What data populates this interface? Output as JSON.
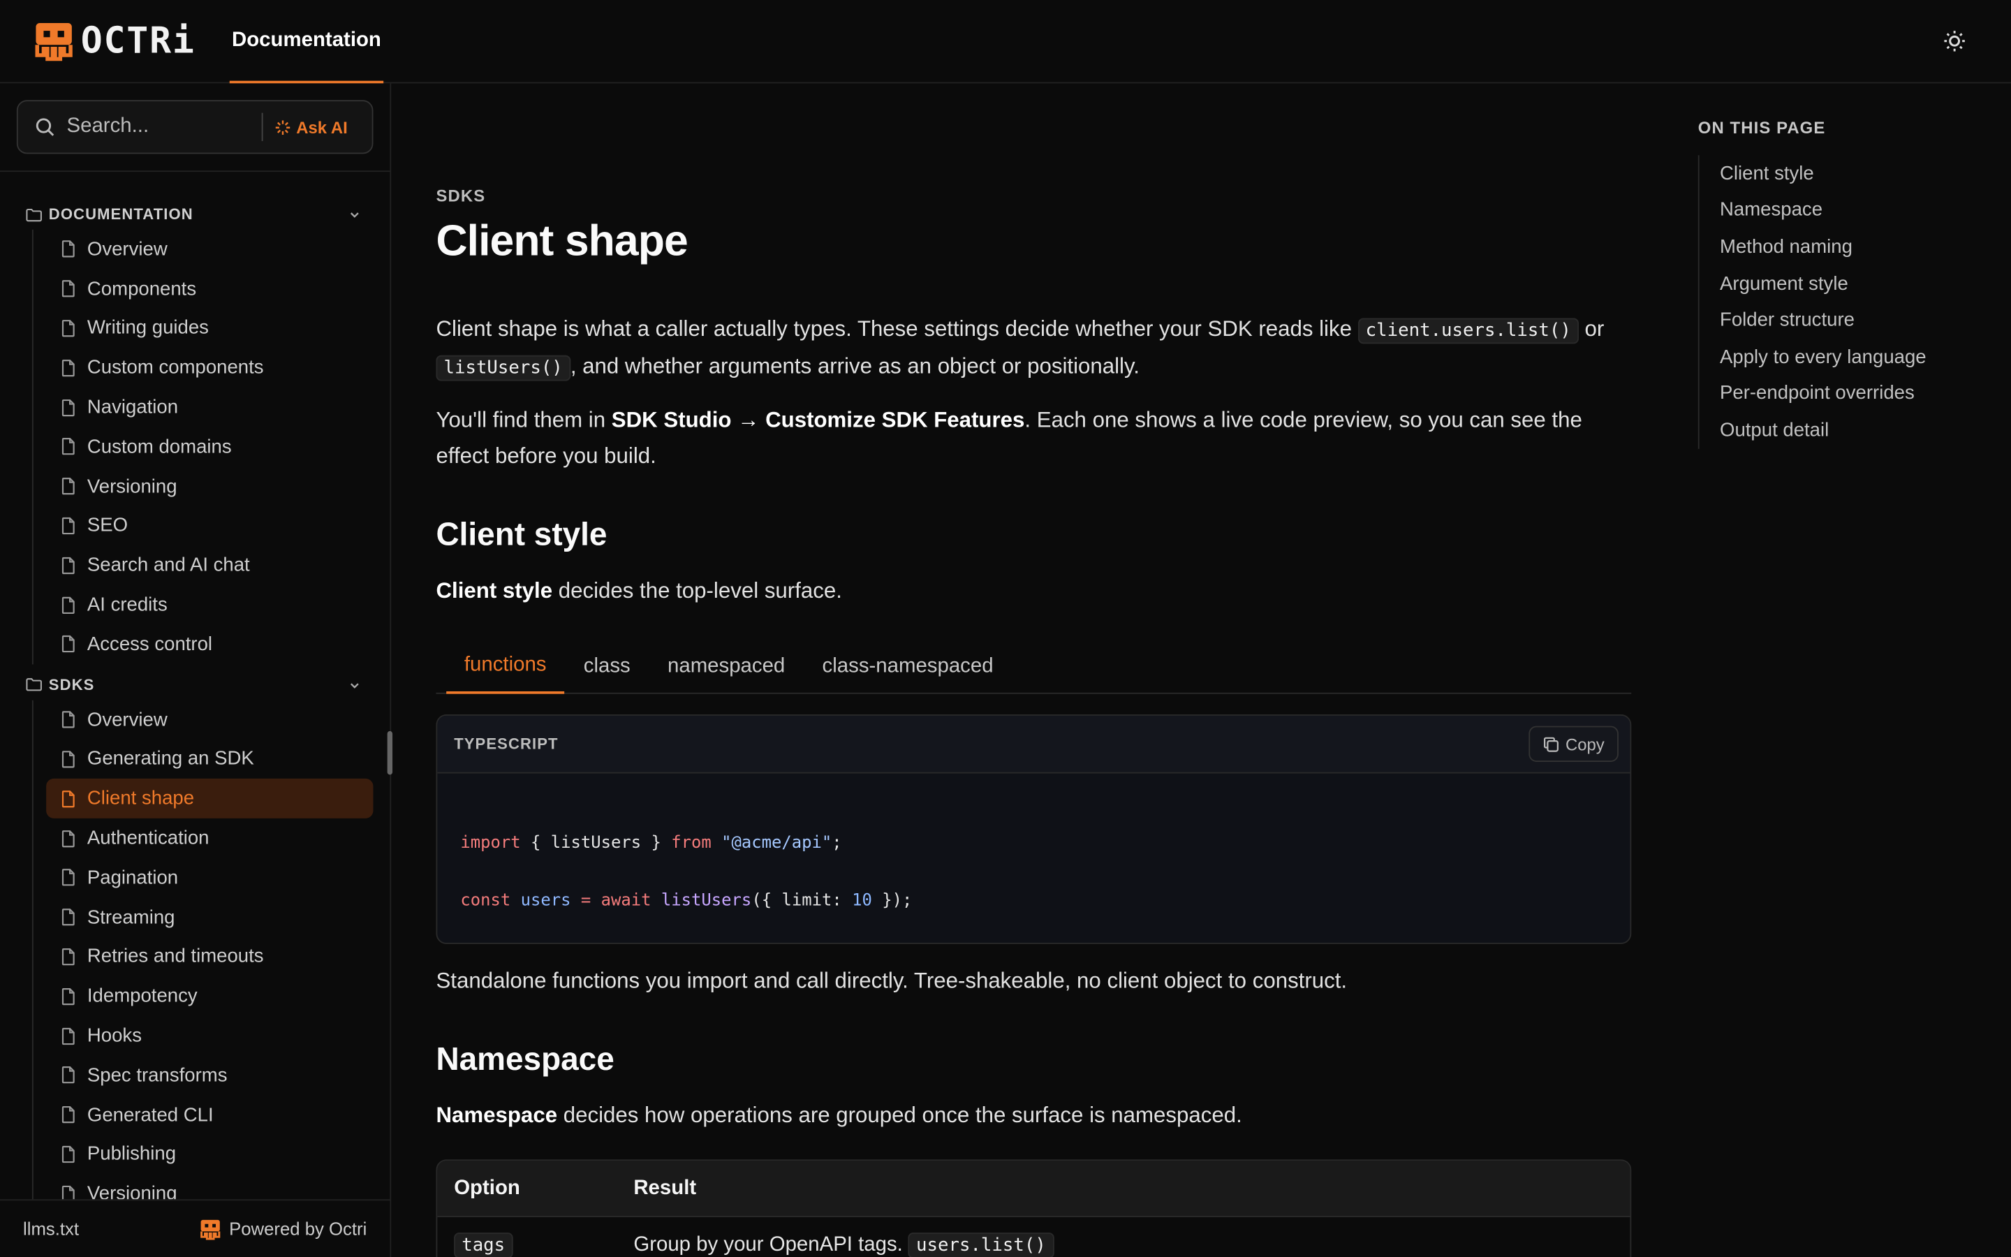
{
  "header": {
    "logo_text": "OCTRi",
    "nav_tab": "Documentation",
    "theme_icon": "sun-icon"
  },
  "sidebar": {
    "search": {
      "placeholder": "Search...",
      "ask_ai": "Ask AI"
    },
    "sections": [
      {
        "title": "DOCUMENTATION",
        "items": [
          "Overview",
          "Components",
          "Writing guides",
          "Custom components",
          "Navigation",
          "Custom domains",
          "Versioning",
          "SEO",
          "Search and AI chat",
          "AI credits",
          "Access control"
        ]
      },
      {
        "title": "SDKS",
        "items": [
          "Overview",
          "Generating an SDK",
          "Client shape",
          "Authentication",
          "Pagination",
          "Streaming",
          "Retries and timeouts",
          "Idempotency",
          "Hooks",
          "Spec transforms",
          "Generated CLI",
          "Publishing",
          "Versioning"
        ]
      }
    ],
    "active_item": "Client shape",
    "footer": {
      "left": "llms.txt",
      "right": "Powered by Octri"
    }
  },
  "main": {
    "eyebrow": "SDKS",
    "title": "Client shape",
    "intro": {
      "part1": "Client shape is what a caller actually types. These settings decide whether your SDK reads like ",
      "code1": "client.users.list()",
      "part2": " or ",
      "code2": "listUsers()",
      "part3": ", and whether arguments arrive as an object or positionally."
    },
    "studio": {
      "part1": "You'll find them in ",
      "bold": "SDK Studio → Customize SDK Features",
      "part2": ". Each one shows a live code preview, so you can see the effect before you build."
    },
    "client_style": {
      "heading": "Client style",
      "lead_bold": "Client style",
      "lead_rest": " decides the top-level surface.",
      "tabs": [
        "functions",
        "class",
        "namespaced",
        "class-namespaced"
      ],
      "active_tab": "functions",
      "code": {
        "language": "TYPESCRIPT",
        "copy_label": "Copy",
        "line1": {
          "kw1": "import",
          "mid": " { listUsers } ",
          "kw2": "from",
          "str": "\"@acme/api\"",
          "end": ";"
        },
        "line2": {
          "kw1": "const",
          "var": "users",
          "op": " = ",
          "kw2": "await",
          "fn": "listUsers",
          "args": "({ limit: ",
          "num": "10",
          "end": " });"
        }
      },
      "caption": "Standalone functions you import and call directly. Tree-shakeable, no client object to construct."
    },
    "namespace": {
      "heading": "Namespace",
      "lead_bold": "Namespace",
      "lead_rest": " decides how operations are grouped once the surface is namespaced.",
      "table": {
        "headers": [
          "Option",
          "Result"
        ],
        "rows": [
          {
            "option": "tags",
            "result_text": "Group by your OpenAPI tags. ",
            "result_code": "users.list()"
          }
        ]
      }
    }
  },
  "toc": {
    "title": "ON THIS PAGE",
    "items": [
      "Client style",
      "Namespace",
      "Method naming",
      "Argument style",
      "Folder structure",
      "Apply to every language",
      "Per-endpoint overrides",
      "Output detail"
    ]
  },
  "colors": {
    "accent": "#f07a2a",
    "background": "#0b0b0b",
    "active_bg": "#3a1d0d"
  }
}
